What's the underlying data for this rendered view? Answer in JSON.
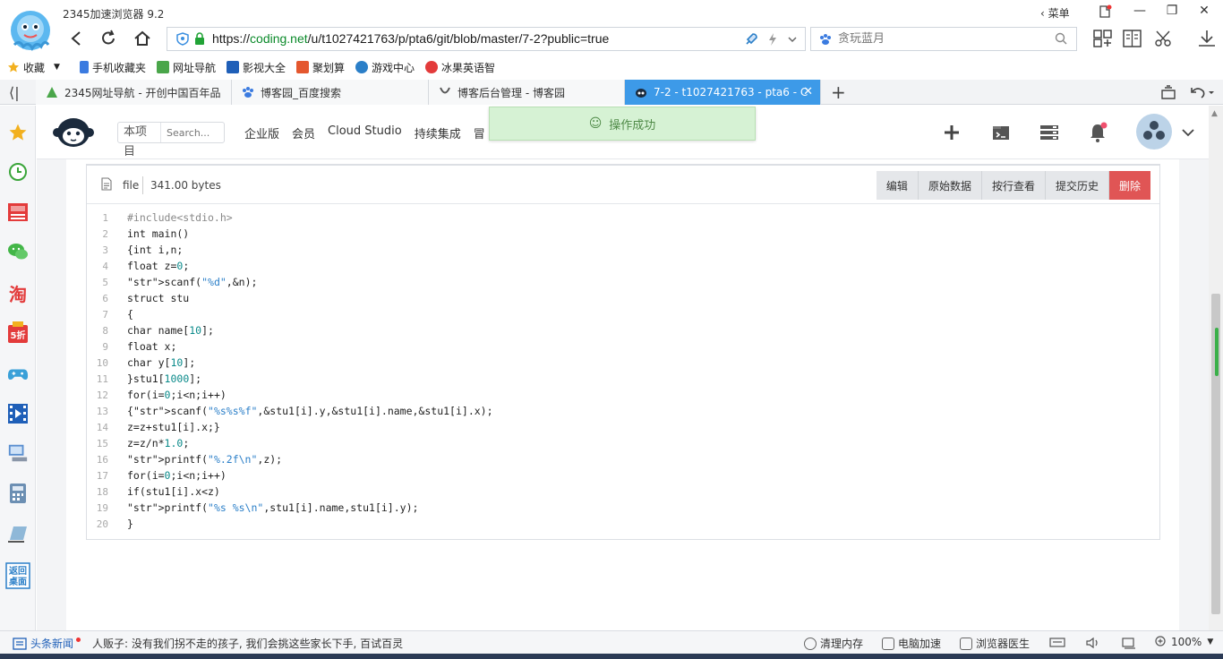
{
  "browser": {
    "app_title": "2345加速浏览器 9.2",
    "url_prefix": "https://",
    "url_host": "coding.net",
    "url_path": "/u/t1027421763/p/pta6/git/blob/master/7-2?public=true",
    "search_placeholder": "贪玩蓝月",
    "menu_label": "菜单"
  },
  "favorites": [
    {
      "label": "收藏",
      "color": "#f2b01e"
    },
    {
      "label": "手机收藏夹",
      "color": "#3b7be0"
    },
    {
      "label": "网址导航",
      "color": "#4aa64a"
    },
    {
      "label": "影视大全",
      "color": "#1f5fb8"
    },
    {
      "label": "聚划算",
      "color": "#e4572e"
    },
    {
      "label": "游戏中心",
      "color": "#2b7fc8"
    },
    {
      "label": "冰果英语智",
      "color": "#e33b3b"
    }
  ],
  "tabs": [
    {
      "label": "2345网址导航 - 开创中国百年品"
    },
    {
      "label": "博客园_百度搜索"
    },
    {
      "label": "博客后台管理 - 博客园"
    },
    {
      "label": "7-2 - t1027421763 - pta6 - C"
    }
  ],
  "site": {
    "search_scope": "本项目",
    "search_placeholder": "Search...",
    "nav": [
      "企业版",
      "会员",
      "Cloud Studio",
      "持续集成",
      "冒"
    ],
    "toast": "操作成功"
  },
  "file": {
    "type": "file",
    "size": "341.00 bytes",
    "buttons": {
      "edit": "编辑",
      "raw": "原始数据",
      "blame": "按行查看",
      "history": "提交历史",
      "delete": "删除"
    },
    "lines": [
      "#include<stdio.h>",
      "int main()",
      "{int i,n;",
      "float z=0;",
      "scanf(\"%d\",&n);",
      "struct stu",
      "{",
      "char name[10];",
      "float x;",
      "char y[10];",
      "}stu1[1000];",
      "for(i=0;i<n;i++)",
      "{scanf(\"%s%s%f\",&stu1[i].y,&stu1[i].name,&stu1[i].x);",
      "z=z+stu1[i].x;}",
      "z=z/n*1.0;",
      "printf(\"%.2f\\n\",z);",
      "for(i=0;i<n;i++)",
      "if(stu1[i].x<z)",
      "printf(\"%s %s\\n\",stu1[i].name,stu1[i].y);",
      "}"
    ]
  },
  "statusbar": {
    "news_label": "头条新闻",
    "news_text": "人贩子: 没有我们拐不走的孩子, 我们会挑这些家长下手, 百试百灵",
    "clean": "清理内存",
    "speedup": "电脑加速",
    "doctor": "浏览器医生",
    "zoom": "100%"
  }
}
